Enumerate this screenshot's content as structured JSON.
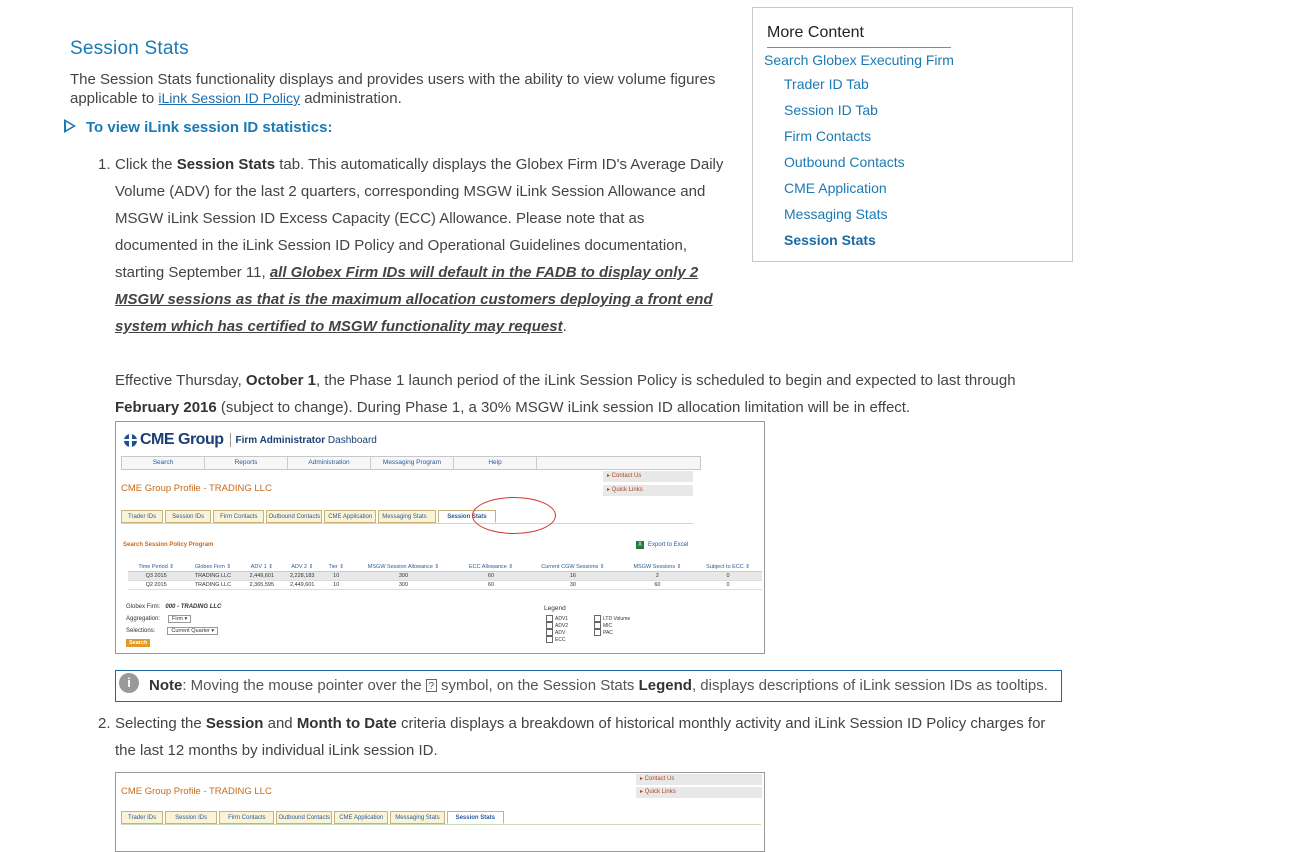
{
  "title": "Session Stats",
  "intro": {
    "text_before": "The Session Stats functionality displays and provides users with the ability to view volume figures applicable to ",
    "link": "iLink Session ID Policy",
    "text_after": " administration."
  },
  "expander_label": "To view iLink session ID statistics:",
  "sidebar": {
    "heading": "More Content",
    "top_link": "Search Globex Executing Firm",
    "items": [
      "Trader ID Tab",
      "Session ID Tab",
      "Firm Contacts",
      "Outbound Contacts",
      "CME Application",
      "Messaging Stats",
      "Session Stats"
    ]
  },
  "step1": {
    "number": "1.",
    "p1_a": "Click the ",
    "p1_b": "Session Stats",
    "p1_c": " tab. This automatically displays the Globex Firm ID's Average Daily Volume (ADV) for the last 2 quarters, corresponding MSGW iLink Session Allowance and MSGW iLink Session ID Excess Capacity (ECC) Allowance. Please note that as documented in the iLink Session ID Policy and Operational Guidelines documentation, starting September 11, ",
    "p1_em": "all Globex Firm IDs will default in the FADB to display only 2 MSGW sessions as that is the maximum allocation customers deploying a front end system which has certified to MSGW functionality may request",
    "p1_end": ".",
    "p2_a": "Effective Thursday, ",
    "p2_b": "October 1",
    "p2_c": ", the Phase 1 launch period of the iLink Session Policy is scheduled to begin and expected to last through ",
    "p2_d": "February 2016",
    "p2_e": " (subject to change). During Phase 1, a 30% MSGW iLink session ID allocation limitation will be in effect."
  },
  "screenshot1": {
    "brand": "CME Group",
    "fa_bold": "Firm Administrator",
    "fa_rest": " Dashboard",
    "nav": [
      "Search",
      "Reports",
      "Administration",
      "Messaging Program",
      "Help"
    ],
    "contact_us": "▸ Contact Us",
    "quick_links": "▸ Quick Links",
    "profile_title": "CME Group Profile - TRADING  LLC",
    "tabs": [
      "Trader IDs",
      "Session IDs",
      "Firm Contacts",
      "Outbound Contacts",
      "CME Application",
      "Messaging Stats",
      "Session Stats"
    ],
    "search_policy": "Search Session Policy Program",
    "export": "Export to Excel",
    "columns": [
      "Time Period ⇕",
      "Globex Firm ⇕",
      "ADV 1 ⇕",
      "ADV 2 ⇕",
      "Tier ⇕",
      "MSGW Session Allowance ⇕",
      "ECC Allowance ⇕",
      "Current CGW Sessions ⇕",
      "MSGW Sessions ⇕",
      "Subject to ECC ⇕"
    ],
    "rows": [
      [
        "Q3 2015",
        "TRADING LLC",
        "2,449,601",
        "2,228,183",
        "10",
        "300",
        "60",
        "16",
        "2",
        "0"
      ],
      [
        "Q2 2015",
        "TRADING LLC",
        "2,365,595",
        "2,449,601",
        "10",
        "300",
        "60",
        "30",
        "60",
        "0"
      ]
    ],
    "globex_firm_label": "Globex Firm:",
    "globex_firm_value": "000 - TRADING LLC",
    "aggregation_label": "Aggregation:",
    "aggregation_value": "Firm       ▾",
    "selections_label": "Selections:",
    "selections_value": "Current Quarter  ▾",
    "search_button": "Search",
    "legend_title": "Legend",
    "legend_left": [
      "ADV1",
      "ADV2",
      "ADV",
      "ECC"
    ],
    "legend_right": [
      "LTD Volume",
      "MIC",
      "PAC"
    ]
  },
  "note": {
    "icon": "i",
    "label": "Note",
    "text_a": ": Moving the mouse pointer over the ",
    "qmark": "?",
    "text_b": " symbol, on the Session Stats ",
    "legend": "Legend",
    "text_c": ", displays descriptions of iLink session IDs as tooltips."
  },
  "step2": {
    "number": "2.",
    "a": "Selecting the ",
    "b": "Session",
    "c": " and ",
    "d": "Month to Date",
    "e": " criteria displays a breakdown of historical monthly activity and iLink Session ID Policy charges for the last 12 months by individual iLink session ID."
  },
  "screenshot2": {
    "contact_us": "▸ Contact Us",
    "quick_links": "▸ Quick Links",
    "profile_title": "CME Group Profile - TRADING LLC",
    "tabs": [
      "Trader IDs",
      "Session IDs",
      "Firm Contacts",
      "Outbound Contacts",
      "CME Application",
      "Messaging Stats",
      "Session Stats"
    ]
  },
  "colors": {
    "link_blue": "#1a7ab3",
    "orange": "#c96a1b",
    "highlight_red": "#d5352d",
    "note_border": "#1a6aa3"
  }
}
